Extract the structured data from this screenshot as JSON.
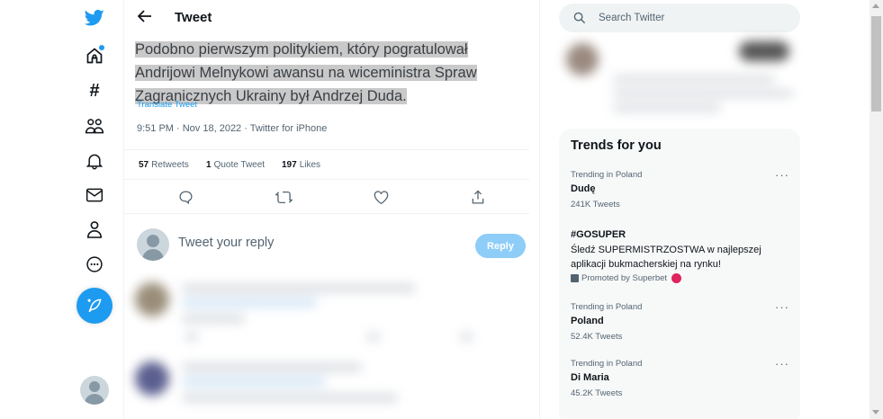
{
  "header": {
    "title": "Tweet"
  },
  "tweet": {
    "text_lines": [
      "Podobno pierwszym politykiem, który pogratulował",
      "Andrijowi Melnykowi awansu na wiceministra Spraw",
      "Zagranicznych Ukrainy był Andrzej Duda."
    ],
    "translate_label": "Translate Tweet",
    "meta": "9:51 PM · Nov 18, 2022 · Twitter for iPhone",
    "stats": [
      {
        "count": "57",
        "label": "Retweets"
      },
      {
        "count": "1",
        "label": "Quote Tweet"
      },
      {
        "count": "197",
        "label": "Likes"
      }
    ]
  },
  "reply": {
    "placeholder": "Tweet your reply",
    "button_label": "Reply"
  },
  "search": {
    "placeholder": "Search Twitter"
  },
  "trends": {
    "title": "Trends for you",
    "items": [
      {
        "context": "Trending in Poland",
        "name": "Dudę",
        "count": "241K Tweets",
        "more": "···"
      },
      {
        "name": "#GOSUPER",
        "description": "Śledź SUPERMISTRZOSTWA w najlepszej aplikacji bukmacherskiej na rynku!",
        "promoted": "Promoted by Superbet"
      },
      {
        "context": "Trending in Poland",
        "name": "Poland",
        "count": "52.4K Tweets",
        "more": "···"
      },
      {
        "context": "Trending in Poland",
        "name": "Di Maria",
        "count": "45.2K Tweets",
        "more": "···"
      }
    ]
  },
  "nav_icons": [
    "twitter-logo-icon",
    "home-icon",
    "hashtag-icon",
    "communities-icon",
    "bell-icon",
    "mail-icon",
    "profile-icon",
    "more-icon",
    "compose-tweet-icon"
  ],
  "colors": {
    "accent": "#1d9bf0",
    "reply_button": "#8ecdf8",
    "promo_dot": "#e0245e"
  }
}
